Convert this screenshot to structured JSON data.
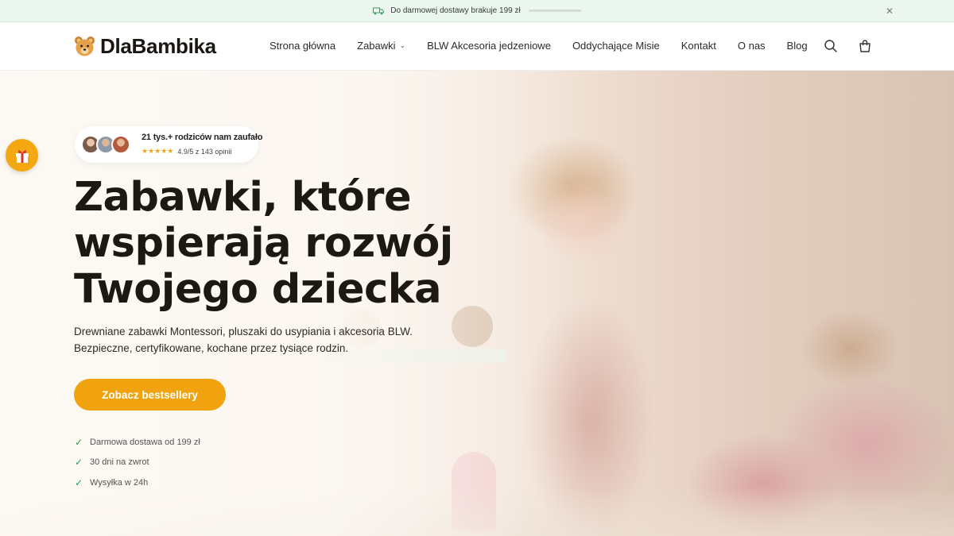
{
  "announcement": {
    "text": "Do darmowej dostawy brakuje 199 zł",
    "icon": "truck-icon",
    "close_icon": "close-icon",
    "progress": 0
  },
  "header": {
    "logo_text": "DlaBambika",
    "logo_icon": "teddy-bear-icon",
    "nav": [
      {
        "label": "Strona główna"
      },
      {
        "label": "Zabawki",
        "has_dropdown": true
      },
      {
        "label": "BLW Akcesoria jedzeniowe"
      },
      {
        "label": "Oddychające Misie"
      },
      {
        "label": "Kontakt"
      },
      {
        "label": "O nas"
      },
      {
        "label": "Blog"
      }
    ],
    "icons": [
      "search-icon",
      "cart-icon"
    ]
  },
  "hero": {
    "trust": {
      "title": "21 tys.+ rodziców nam zaufało",
      "stars": "★★★★★",
      "rating": "4.9/5 z 143 opinii"
    },
    "heading": "Zabawki, które wspierają rozwój Twojego dziecka",
    "description": "Drewniane zabawki Montessori, pluszaki do usypiania i akcesoria BLW. Bezpieczne, certyfikowane, kochane przez tysiące rodzin.",
    "cta": "Zobacz bestsellery",
    "perks": [
      "Darmowa dostawa od 199 zł",
      "30 dni na zwrot",
      "Wysyłka w 24h"
    ]
  },
  "floating": {
    "gift_icon": "gift-icon"
  },
  "colors": {
    "accent": "#f0a30e",
    "announcement_bg": "#eaf6ee",
    "check": "#2e9a55",
    "stars": "#f2a516"
  }
}
